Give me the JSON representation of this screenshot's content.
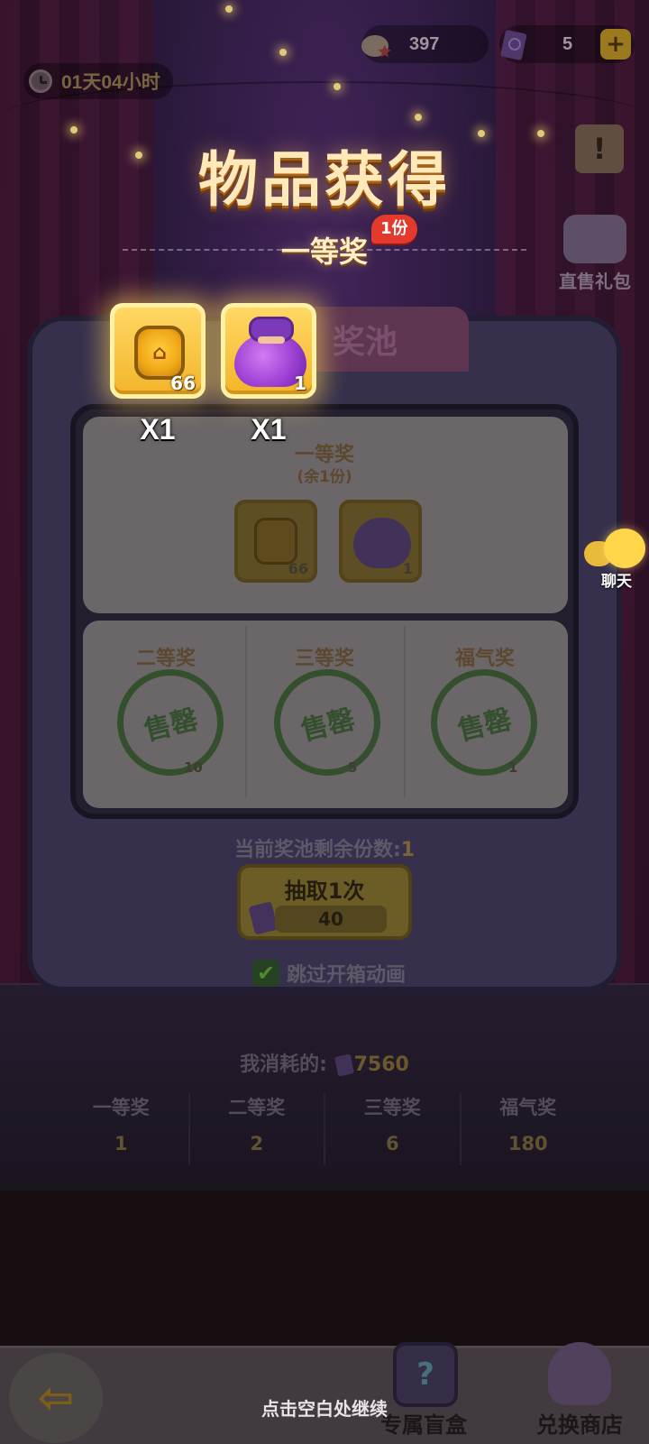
{
  "timer": {
    "text": "01天04小时"
  },
  "currencies": [
    {
      "icon": "star-egg-icon",
      "value": "397"
    },
    {
      "icon": "ticket-icon",
      "value": "5"
    }
  ],
  "plus_label": "+",
  "side": {
    "notice_icon": "!",
    "gift_label": "直售礼包"
  },
  "overlay": {
    "title": "物品获得",
    "tier_name": "一等奖",
    "tier_badge": "1份",
    "rewards": [
      {
        "icon": "coin-icon",
        "count": "66",
        "multiplier": "X1"
      },
      {
        "icon": "purple-bag-icon",
        "count": "1",
        "multiplier": "X1"
      }
    ]
  },
  "pool": {
    "tab_label": "奖池",
    "first_prize": {
      "title": "一等奖",
      "remaining": "(余1份)",
      "items": [
        {
          "count": "66"
        },
        {
          "count": "1"
        }
      ]
    },
    "other_prizes": [
      {
        "title": "二等奖",
        "stamp": "售罄",
        "count": "10"
      },
      {
        "title": "三等奖",
        "stamp": "售罄",
        "count": "5"
      },
      {
        "title": "福气奖",
        "stamp": "售罄",
        "count": "1"
      }
    ],
    "remain_label": "当前奖池剩余份数:",
    "remain_value": "1",
    "draw_button": {
      "label": "抽取1次",
      "cost": "40"
    },
    "skip_label": "跳过开箱动画",
    "skip_checked": "✔"
  },
  "consumed": {
    "label": "我消耗的:",
    "value": "7560"
  },
  "stats": [
    {
      "name": "一等奖",
      "value": "1"
    },
    {
      "name": "二等奖",
      "value": "2"
    },
    {
      "name": "三等奖",
      "value": "6"
    },
    {
      "name": "福气奖",
      "value": "180"
    }
  ],
  "chat": {
    "label": "聊天"
  },
  "bottom": {
    "back_icon": "⇦",
    "continue_hint": "点击空白处继续",
    "blind_box_label": "专属盲盒",
    "shop_label": "兑换商店"
  }
}
